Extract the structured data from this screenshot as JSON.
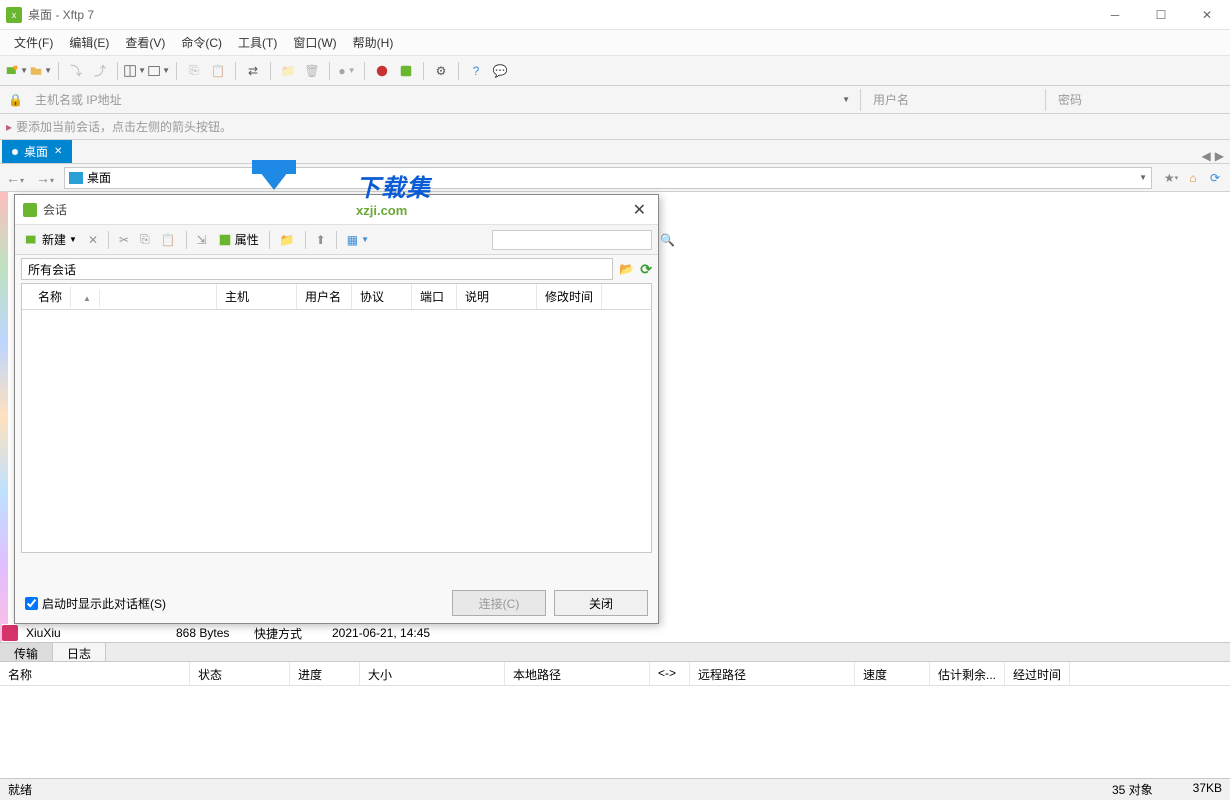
{
  "titlebar": {
    "title": "桌面 - Xftp 7"
  },
  "menu": {
    "file": "文件(F)",
    "edit": "编辑(E)",
    "view": "查看(V)",
    "command": "命令(C)",
    "tool": "工具(T)",
    "window": "窗口(W)",
    "help": "帮助(H)"
  },
  "addr": {
    "placeholder": "主机名或 IP地址",
    "user_placeholder": "用户名",
    "pass_placeholder": "密码"
  },
  "hint": "要添加当前会话，点击左侧的箭头按钮。",
  "tab": {
    "label": "桌面"
  },
  "path": {
    "value": "桌面"
  },
  "watermark": {
    "big": "下载集",
    "small": "xzji.com"
  },
  "filerow": {
    "name": "XiuXiu",
    "size": "868 Bytes",
    "type": "快捷方式",
    "date": "2021-06-21, 14:45"
  },
  "transfer_tabs": {
    "t1": "传输",
    "t2": "日志"
  },
  "transfer_cols": {
    "name": "名称",
    "status": "状态",
    "progress": "进度",
    "size": "大小",
    "local": "本地路径",
    "arrow": "<->",
    "remote": "远程路径",
    "speed": "速度",
    "eta": "估计剩余...",
    "elapsed": "经过时间"
  },
  "status": {
    "ready": "就绪",
    "objects": "35 对象",
    "total": "37KB"
  },
  "dialog": {
    "title": "会话",
    "new": "新建",
    "props": "属性",
    "all_sessions": "所有会话",
    "cols": {
      "name": "名称",
      "host": "主机",
      "user": "用户名",
      "proto": "协议",
      "port": "端口",
      "desc": "说明",
      "mtime": "修改时间"
    },
    "show_on_start": "启动时显示此对话框(S)",
    "connect": "连接(C)",
    "close": "关闭"
  }
}
